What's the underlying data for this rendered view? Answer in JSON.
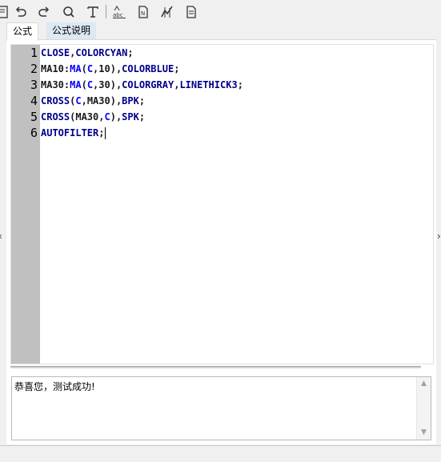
{
  "toolbar": {
    "buttons": [
      {
        "name": "save-icon"
      },
      {
        "name": "undo-icon"
      },
      {
        "name": "redo-icon"
      },
      {
        "name": "find-icon"
      },
      {
        "name": "text-format-icon"
      },
      {
        "name": "spell-check-icon"
      },
      {
        "name": "insert-function-icon"
      },
      {
        "name": "chart-test-icon"
      },
      {
        "name": "document-icon"
      }
    ]
  },
  "tabs": [
    {
      "label": "公式",
      "active": true
    },
    {
      "label": "公式说明",
      "active": false
    }
  ],
  "editor": {
    "line_numbers": [
      "1",
      "2",
      "3",
      "4",
      "5",
      "6"
    ],
    "lines": [
      [
        {
          "t": "CLOSE",
          "c": "kw"
        },
        {
          "t": ",",
          "c": "plain"
        },
        {
          "t": "COLORCYAN",
          "c": "kw"
        },
        {
          "t": ";",
          "c": "plain"
        }
      ],
      [
        {
          "t": "MA10:",
          "c": "plain"
        },
        {
          "t": "MA",
          "c": "fn"
        },
        {
          "t": "(",
          "c": "plain"
        },
        {
          "t": "C",
          "c": "fn"
        },
        {
          "t": ",10),",
          "c": "plain"
        },
        {
          "t": "COLORBLUE",
          "c": "kw"
        },
        {
          "t": ";",
          "c": "plain"
        }
      ],
      [
        {
          "t": "MA30:",
          "c": "plain"
        },
        {
          "t": "MA",
          "c": "fn"
        },
        {
          "t": "(",
          "c": "plain"
        },
        {
          "t": "C",
          "c": "fn"
        },
        {
          "t": ",30),",
          "c": "plain"
        },
        {
          "t": "COLORGRAY",
          "c": "kw"
        },
        {
          "t": ",",
          "c": "plain"
        },
        {
          "t": "LINETHICK3",
          "c": "kw"
        },
        {
          "t": ";",
          "c": "plain"
        }
      ],
      [
        {
          "t": "CROSS",
          "c": "kw"
        },
        {
          "t": "(",
          "c": "plain"
        },
        {
          "t": "C",
          "c": "fn"
        },
        {
          "t": ",MA30),",
          "c": "plain"
        },
        {
          "t": "BPK",
          "c": "kw"
        },
        {
          "t": ";",
          "c": "plain"
        }
      ],
      [
        {
          "t": "CROSS",
          "c": "kw"
        },
        {
          "t": "(MA30,",
          "c": "plain"
        },
        {
          "t": "C",
          "c": "fn"
        },
        {
          "t": "),",
          "c": "plain"
        },
        {
          "t": "SPK",
          "c": "kw"
        },
        {
          "t": ";",
          "c": "plain"
        }
      ],
      [
        {
          "t": "AUTOFILTER",
          "c": "kw"
        },
        {
          "t": ";",
          "c": "plain"
        }
      ]
    ],
    "colors": {
      "keyword": "#00008b",
      "function": "#0000ff",
      "plain": "#1a1a1a",
      "gutter": "#c0c0c0"
    }
  },
  "output": {
    "message": "恭喜您，测试成功!"
  },
  "side": {
    "left_arrow": "‹",
    "right_arrow": "›"
  },
  "scroll": {
    "up": "▲",
    "down": "▼"
  }
}
